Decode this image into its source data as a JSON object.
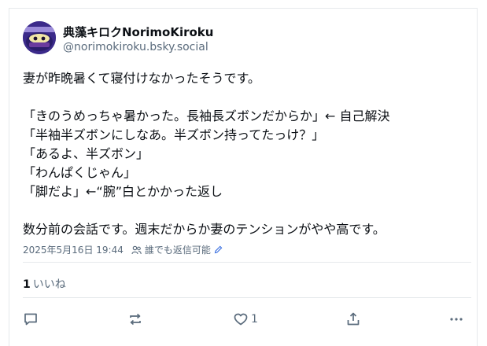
{
  "author": {
    "display_name": "典藻キロクNorimoKiroku",
    "handle": "@norimokiroku.bsky.social",
    "avatar_icon": "purple-ninja-avatar"
  },
  "post": {
    "lines": [
      "妻が昨晩暑くて寝付けなかったそうです。",
      "",
      "「きのうめっちゃ暑かった。長袖長ズボンだからか」← 自己解決",
      "「半袖半ズボンにしなあ。半ズボン持ってたっけ？」",
      "「あるよ、半ズボン」",
      "「わんぱくじゃん」",
      "「脚だよ」←“腕”白とかかった返し",
      "",
      "数分前の会話です。週末だからか妻のテンションがやや高です。"
    ]
  },
  "meta": {
    "timestamp": "2025年5月16日 19:44",
    "reply_setting": "誰でも返信可能"
  },
  "stats": {
    "like_count": "1",
    "like_label": "いいね"
  },
  "actions": {
    "reply_icon": "reply-icon",
    "repost_icon": "repost-icon",
    "like_icon": "heart-icon",
    "like_count": "1",
    "share_icon": "share-icon",
    "more_icon": "more-icon"
  },
  "colors": {
    "text": "#0b0f14",
    "muted": "#5a6b7c",
    "divider": "#e6e9ec",
    "avatar_bg": "#3b2a8a"
  }
}
